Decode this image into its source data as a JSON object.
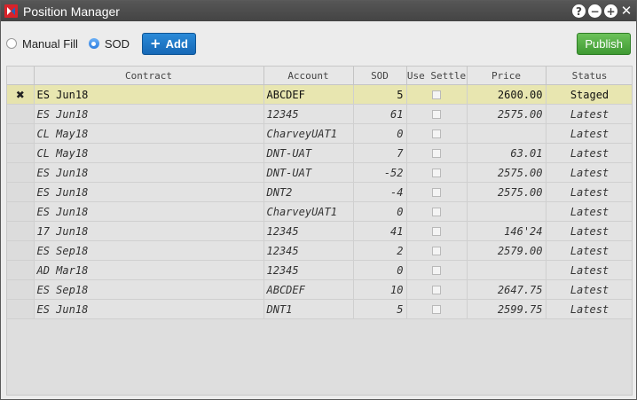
{
  "window": {
    "title": "Position Manager"
  },
  "toolbar": {
    "mode_options": [
      {
        "label": "Manual Fill",
        "checked": false
      },
      {
        "label": "SOD",
        "checked": true
      }
    ],
    "add_label": "Add",
    "publish_label": "Publish"
  },
  "grid": {
    "columns": [
      "Contract",
      "Account",
      "SOD",
      "Use Settle",
      "Price",
      "Status"
    ],
    "rows": [
      {
        "contract": "ES Jun18",
        "account": "ABCDEF",
        "sod": "5",
        "use_settle": false,
        "price": "2600.00",
        "status": "Staged",
        "staged": true
      },
      {
        "contract": "ES Jun18",
        "account": "12345",
        "sod": "61",
        "use_settle": false,
        "price": "2575.00",
        "status": "Latest",
        "staged": false
      },
      {
        "contract": "CL May18",
        "account": "CharveyUAT1",
        "sod": "0",
        "use_settle": false,
        "price": "",
        "status": "Latest",
        "staged": false
      },
      {
        "contract": "CL May18",
        "account": "DNT-UAT",
        "sod": "7",
        "use_settle": false,
        "price": "63.01",
        "status": "Latest",
        "staged": false
      },
      {
        "contract": "ES Jun18",
        "account": "DNT-UAT",
        "sod": "-52",
        "use_settle": false,
        "price": "2575.00",
        "status": "Latest",
        "staged": false
      },
      {
        "contract": "ES Jun18",
        "account": "DNT2",
        "sod": "-4",
        "use_settle": false,
        "price": "2575.00",
        "status": "Latest",
        "staged": false
      },
      {
        "contract": "ES Jun18",
        "account": "CharveyUAT1",
        "sod": "0",
        "use_settle": false,
        "price": "",
        "status": "Latest",
        "staged": false
      },
      {
        "contract": "17 Jun18",
        "account": "12345",
        "sod": "41",
        "use_settle": false,
        "price": "146'24",
        "status": "Latest",
        "staged": false
      },
      {
        "contract": "ES Sep18",
        "account": "12345",
        "sod": "2",
        "use_settle": false,
        "price": "2579.00",
        "status": "Latest",
        "staged": false
      },
      {
        "contract": "AD Mar18",
        "account": "12345",
        "sod": "0",
        "use_settle": false,
        "price": "",
        "status": "Latest",
        "staged": false
      },
      {
        "contract": "ES Sep18",
        "account": "ABCDEF",
        "sod": "10",
        "use_settle": false,
        "price": "2647.75",
        "status": "Latest",
        "staged": false
      },
      {
        "contract": "ES Jun18",
        "account": "DNT1",
        "sod": "5",
        "use_settle": false,
        "price": "2599.75",
        "status": "Latest",
        "staged": false
      }
    ]
  },
  "colors": {
    "accent": "#1f7bd0",
    "publish": "#4fae40",
    "staged_row": "#e8e6b0",
    "titlebar": "#4a4a4a"
  }
}
